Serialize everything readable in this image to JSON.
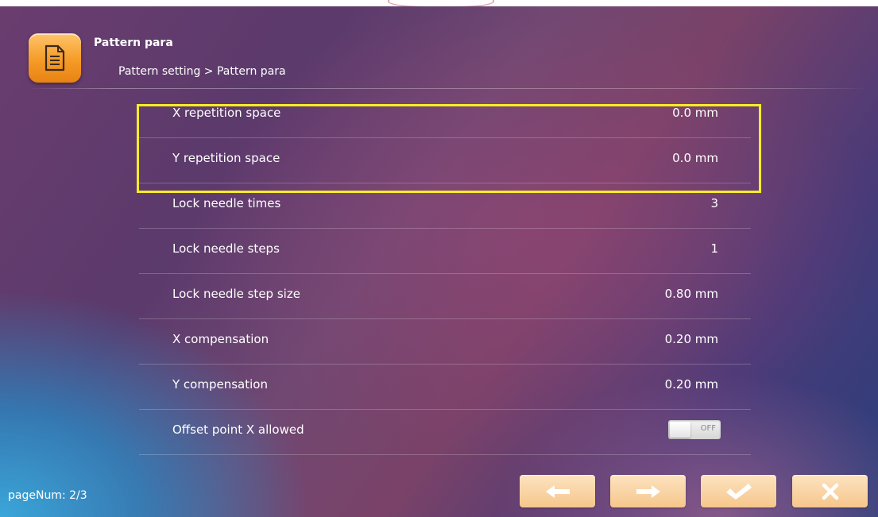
{
  "header": {
    "title": "Pattern para",
    "breadcrumb": "Pattern setting > Pattern para",
    "icon": "document-icon"
  },
  "params": [
    {
      "label": "X repetition space",
      "value": "0.0 mm"
    },
    {
      "label": "Y repetition space",
      "value": "0.0 mm"
    },
    {
      "label": "Lock needle times",
      "value": "3"
    },
    {
      "label": "Lock needle steps",
      "value": "1"
    },
    {
      "label": "Lock needle step size",
      "value": "0.80 mm"
    },
    {
      "label": "X compensation",
      "value": "0.20 mm"
    },
    {
      "label": "Y compensation",
      "value": "0.20 mm"
    },
    {
      "label": "Offset point X allowed",
      "toggle": "OFF",
      "toggle_on": false
    }
  ],
  "footer": {
    "page_num": "pageNum: 2/3",
    "buttons": [
      "prev-arrow-icon",
      "next-arrow-icon",
      "check-icon",
      "close-icon"
    ]
  },
  "colors": {
    "highlight": "#f8ec25",
    "button": "#f6c68c",
    "header_icon": "#f59b27"
  }
}
